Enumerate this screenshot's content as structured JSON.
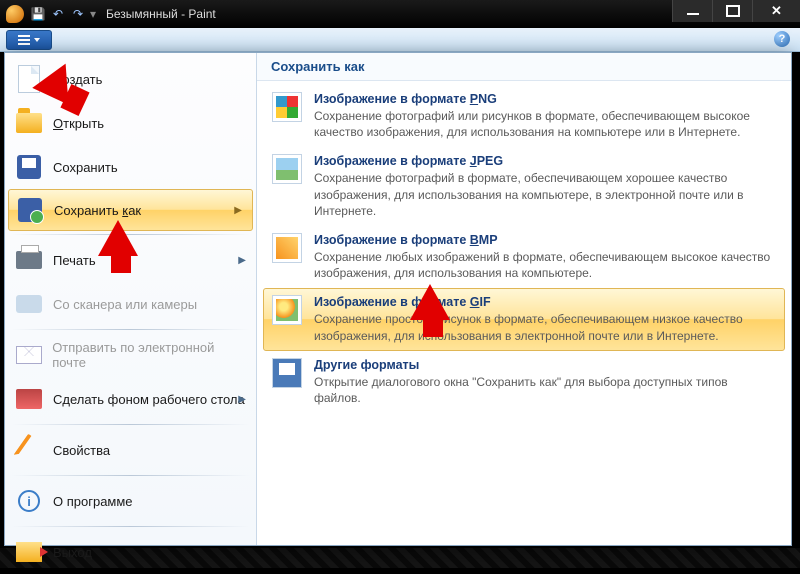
{
  "title": "Безымянный - Paint",
  "menu": {
    "new": "Создать",
    "open": "ткрыть",
    "open_ul": "О",
    "save": "Сохранить",
    "save_as": "Сохранить ",
    "save_as_ul": "к",
    "save_as_after": "ак",
    "print": "Печать",
    "scanner": "Со сканера или камеры",
    "email": "Отправить по электронной почте",
    "wallpaper": "Сделать фоном рабочего стола",
    "properties": "Свойства",
    "about": "О программе",
    "exit": "Выход"
  },
  "right": {
    "header": "Сохранить как",
    "formats": [
      {
        "id": "png",
        "title_pre": "Изображение в формате ",
        "title_ul": "P",
        "title_post": "NG",
        "desc": "Сохранение фотографий или рисунков в формате, обеспечивающем высокое качество изображения, для использования на компьютере или в Интернете."
      },
      {
        "id": "jpeg",
        "title_pre": "Изображение в формате ",
        "title_ul": "J",
        "title_post": "PEG",
        "desc": "Сохранение фотографий в формате, обеспечивающем хорошее качество изображения, для использования на компьютере, в электронной почте или в Интернете."
      },
      {
        "id": "bmp",
        "title_pre": "Изображение в формате ",
        "title_ul": "B",
        "title_post": "MP",
        "desc": "Сохранение любых изображений в формате, обеспечивающем высокое качество изображения, для использования на компьютере."
      },
      {
        "id": "gif",
        "title_pre": "Изображение в формате ",
        "title_ul": "G",
        "title_post": "IF",
        "desc": "Сохранение простого рисунок в формате, обеспечивающем низкое качество изображения, для использования в электронной почте или в Интернете."
      },
      {
        "id": "other",
        "title_pre": "",
        "title_ul": "Д",
        "title_post": "ругие форматы",
        "desc": "Открытие диалогового окна \"Сохранить как\" для выбора доступных типов файлов."
      }
    ]
  }
}
